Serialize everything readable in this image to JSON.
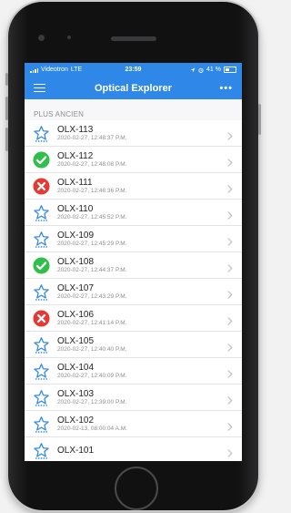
{
  "status_bar": {
    "carrier": "Videotron",
    "network": "LTE",
    "time": "23:59",
    "battery": "41 %"
  },
  "nav": {
    "title": "Optical Explorer",
    "more_label": "•••"
  },
  "section_header": "PLUS ANCIEN",
  "items": [
    {
      "title": "OLX-113",
      "date": "2020-02-27, 12:48:37 P.M.",
      "status": "pending"
    },
    {
      "title": "OLX-112",
      "date": "2020-02-27, 12:48:08 P.M.",
      "status": "pass"
    },
    {
      "title": "OLX-111",
      "date": "2020-02-27, 12:46:36 P.M.",
      "status": "fail"
    },
    {
      "title": "OLX-110",
      "date": "2020-02-27, 12:45:52 P.M.",
      "status": "pending"
    },
    {
      "title": "OLX-109",
      "date": "2020-02-27, 12:45:29 P.M.",
      "status": "pending"
    },
    {
      "title": "OLX-108",
      "date": "2020-02-27, 12:44:37 P.M.",
      "status": "pass"
    },
    {
      "title": "OLX-107",
      "date": "2020-02-27, 12:43:29 P.M.",
      "status": "pending"
    },
    {
      "title": "OLX-106",
      "date": "2020-02-27, 12:41:14 P.M.",
      "status": "fail"
    },
    {
      "title": "OLX-105",
      "date": "2020-02-27, 12:40:40 P.M.",
      "status": "pending"
    },
    {
      "title": "OLX-104",
      "date": "2020-02-27, 12:40:09 P.M.",
      "status": "pending"
    },
    {
      "title": "OLX-103",
      "date": "2020-02-27, 12:39:00 P.M.",
      "status": "pending"
    },
    {
      "title": "OLX-102",
      "date": "2020-02-13, 08:00:04 A.M.",
      "status": "pending"
    },
    {
      "title": "OLX-101",
      "date": "",
      "status": "pending"
    }
  ],
  "colors": {
    "accent": "#2f88e8",
    "pass": "#2fbf4a",
    "fail": "#e53935",
    "pending": "#2f88e8"
  },
  "icons": {
    "pass": "check-circle-icon",
    "fail": "x-circle-icon",
    "pending": "star-outline-icon",
    "row_chevron": "chevron-right-icon",
    "menu": "hamburger-menu-icon",
    "more": "more-dots-icon"
  }
}
